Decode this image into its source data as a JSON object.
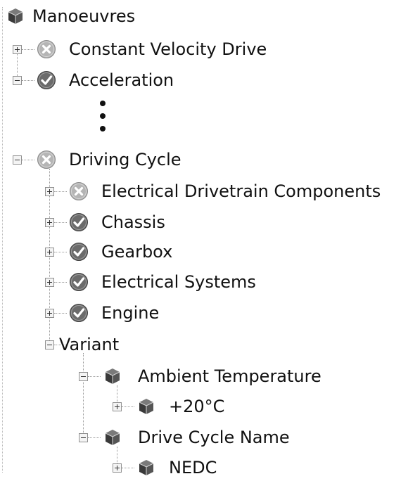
{
  "tree": {
    "root": {
      "label": "Manoeuvres",
      "icon": "cube-icon"
    },
    "constant_velocity_drive": {
      "label": "Constant Velocity Drive",
      "icon": "failed-status-icon"
    },
    "acceleration": {
      "label": "Acceleration",
      "icon": "passed-status-icon"
    },
    "driving_cycle": {
      "label": "Driving Cycle",
      "icon": "failed-status-icon",
      "children": {
        "electrical_drivetrain_components": {
          "label": "Electrical Drivetrain Components",
          "icon": "failed-status-icon"
        },
        "chassis": {
          "label": "Chassis",
          "icon": "passed-status-icon"
        },
        "gearbox": {
          "label": "Gearbox",
          "icon": "passed-status-icon"
        },
        "electrical_systems": {
          "label": "Electrical Systems",
          "icon": "passed-status-icon"
        },
        "engine": {
          "label": "Engine",
          "icon": "passed-status-icon"
        },
        "variant": {
          "label": "Variant",
          "children": {
            "ambient_temperature": {
              "label": "Ambient Temperature",
              "icon": "cube-icon",
              "value": {
                "label": "+20°C",
                "icon": "cube-icon"
              }
            },
            "drive_cycle_name": {
              "label": "Drive Cycle Name",
              "icon": "cube-icon",
              "value": {
                "label": "NEDC",
                "icon": "cube-icon"
              }
            }
          }
        }
      }
    }
  },
  "colors": {
    "passed": "#6b6b6b",
    "failed": "#b5b5b5",
    "cube_top": "#7a7a7a",
    "cube_side": "#3a3a3a"
  }
}
